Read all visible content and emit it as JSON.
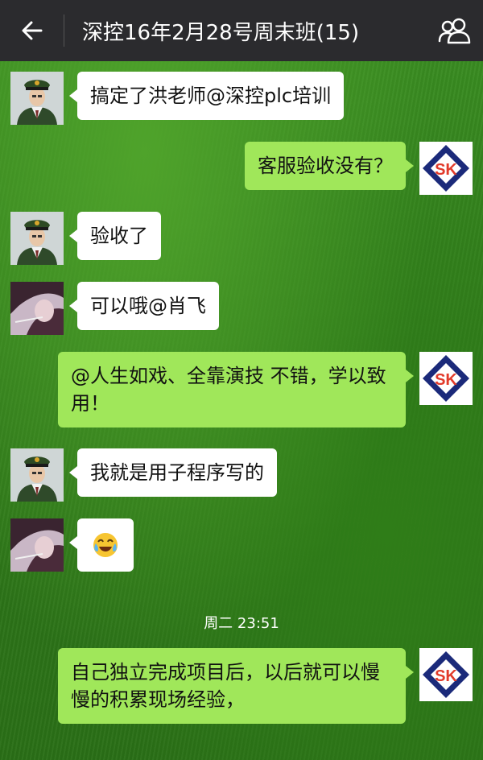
{
  "header": {
    "title": "深控16年2月28号周末班(15)",
    "back_icon": "arrow-left-icon",
    "members_icon": "group-icon"
  },
  "colors": {
    "topbar": "#2b2b2e",
    "bubble_self": "#a0e75a",
    "bubble_other": "#ffffff",
    "sk_blue": "#1b2a7a",
    "sk_red": "#e23b2b"
  },
  "messages": [
    {
      "side": "left",
      "avatar": "soldier-avatar",
      "text": "搞定了洪老师@深控plc培训"
    },
    {
      "side": "right",
      "avatar": "sk-logo-avatar",
      "text": "客服验收没有？"
    },
    {
      "side": "left",
      "avatar": "soldier-avatar",
      "text": "验收了"
    },
    {
      "side": "left",
      "avatar": "girl-avatar",
      "text": "可以哦@肖飞"
    },
    {
      "side": "right",
      "avatar": "sk-logo-avatar",
      "text": "@人生如戏、全靠演技 不错，学以致用！"
    },
    {
      "side": "left",
      "avatar": "soldier-avatar",
      "text": "我就是用子程序写的"
    },
    {
      "side": "left",
      "avatar": "girl-avatar",
      "text": "",
      "emoji": "😂"
    },
    {
      "side": "right",
      "avatar": "sk-logo-avatar",
      "text": "自己独立完成项目后，以后就可以慢慢的积累现场经验，"
    }
  ],
  "timestamp": "周二 23:51",
  "sk_logo_text": "SK"
}
